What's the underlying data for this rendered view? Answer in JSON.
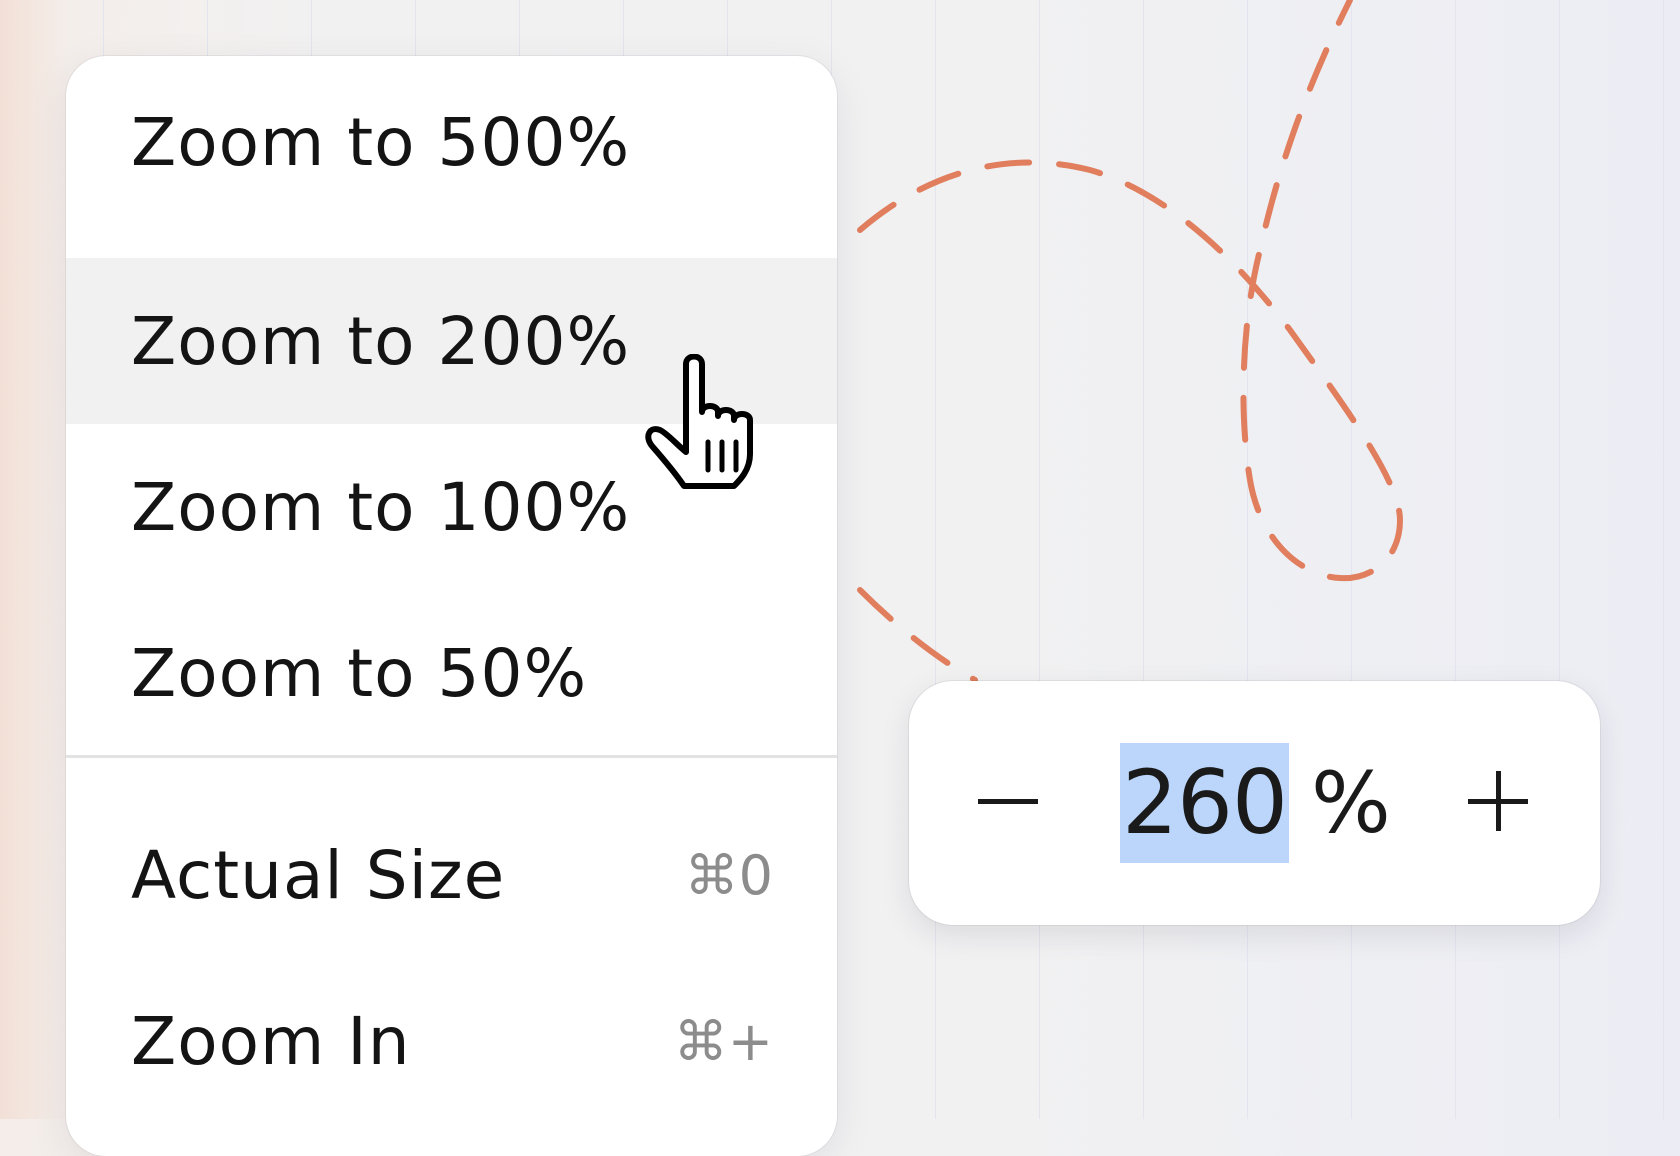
{
  "menu": {
    "items": [
      {
        "label": "Zoom to 500%",
        "shortcut": ""
      },
      {
        "label": "Zoom to 200%",
        "shortcut": ""
      },
      {
        "label": "Zoom to 100%",
        "shortcut": ""
      },
      {
        "label": "Zoom to 50%",
        "shortcut": ""
      },
      {
        "label": "Actual Size",
        "shortcut": "⌘0"
      },
      {
        "label": "Zoom In",
        "shortcut": "⌘+"
      }
    ],
    "hovered_item": "Zoom to 200%"
  },
  "zoom_control": {
    "value": "260",
    "unit": "%",
    "decrease_icon": "minus-icon",
    "increase_icon": "plus-icon"
  },
  "cursor": {
    "icon": "hand-pointer-icon"
  },
  "colors": {
    "doodle_stroke": "#e07e5e",
    "selection": "#bcd6fb",
    "hover": "#f1f1f1"
  }
}
